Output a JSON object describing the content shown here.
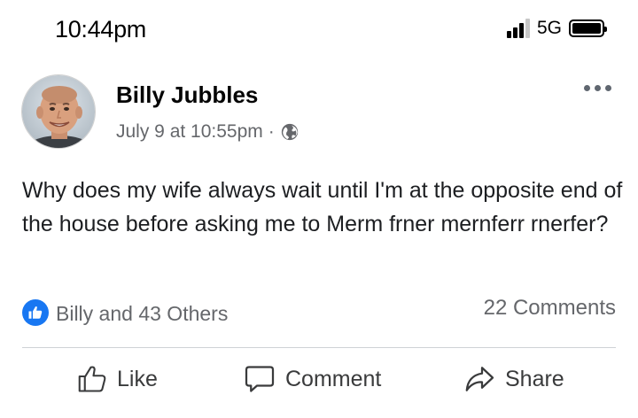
{
  "status_bar": {
    "time": "10:44pm",
    "network": "5G",
    "signal_bars_filled": 3,
    "signal_bars_total": 4,
    "battery_icon": "battery-icon"
  },
  "post": {
    "author": "Billy Jubbles",
    "timestamp": "July 9 at 10:55pm",
    "separator": "·",
    "privacy_icon": "globe-icon",
    "more_icon": "more-options-icon",
    "text": "Why does my wife always wait until I'm at the opposite end of the house before asking me to Merm frner mernferr rnerfer?"
  },
  "reactions": {
    "icon": "like-icon",
    "summary": "Billy and 43 Others",
    "comments": "22 Comments"
  },
  "actions": {
    "like_label": "Like",
    "comment_label": "Comment",
    "share_label": "Share"
  },
  "colors": {
    "accent": "#1877f2",
    "secondary_text": "#65676b",
    "primary_text": "#1c1e21",
    "divider": "#cfd2d6"
  }
}
